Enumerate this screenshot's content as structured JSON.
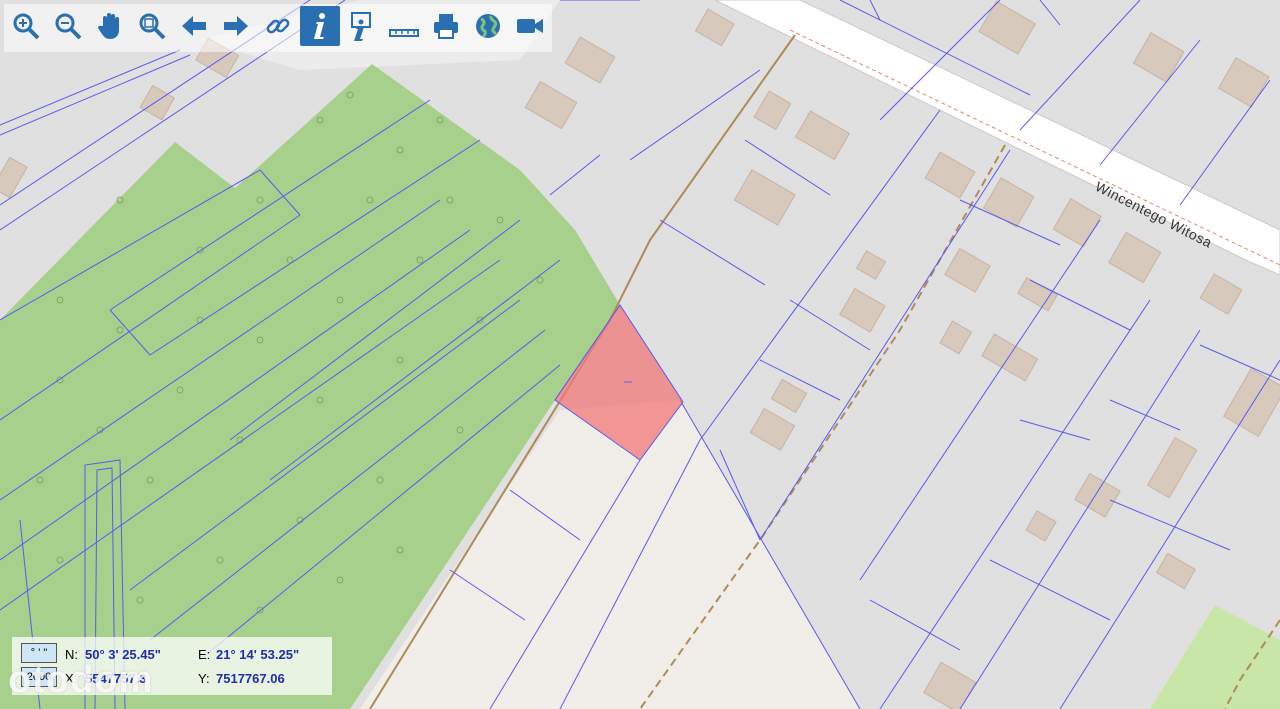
{
  "toolbar": {
    "tools": [
      {
        "name": "zoom-in",
        "icon": "zoom-in-icon"
      },
      {
        "name": "zoom-out",
        "icon": "zoom-out-icon"
      },
      {
        "name": "pan",
        "icon": "hand-icon"
      },
      {
        "name": "zoom-extent",
        "icon": "zoom-box-icon"
      },
      {
        "name": "back",
        "icon": "arrow-left-icon"
      },
      {
        "name": "forward",
        "icon": "arrow-right-icon"
      },
      {
        "name": "link",
        "icon": "link-icon"
      },
      {
        "name": "info",
        "icon": "info-icon",
        "active": true
      },
      {
        "name": "info-extended",
        "icon": "info-pointer-icon"
      },
      {
        "name": "measure",
        "icon": "ruler-icon"
      },
      {
        "name": "print",
        "icon": "printer-icon"
      },
      {
        "name": "globe",
        "icon": "globe-icon"
      },
      {
        "name": "video",
        "icon": "video-camera-icon"
      }
    ]
  },
  "map": {
    "street_label": "Wincentego Witosa",
    "highlight_color": "#f29a9a",
    "forest_color": "#a8d08d",
    "parcel_line_color": "#5a5aee"
  },
  "coords": {
    "format_dms": "° ' \"",
    "format_xy": "2000",
    "n_label": "N:",
    "n_value": "50° 3' 25.45\"",
    "e_label": "E:",
    "e_value": "21° 14' 53.25\"",
    "x_label": "X:",
    "x_value": "5547757.3",
    "y_label": "Y:",
    "y_value": "7517767.06"
  },
  "watermark": "otodom"
}
